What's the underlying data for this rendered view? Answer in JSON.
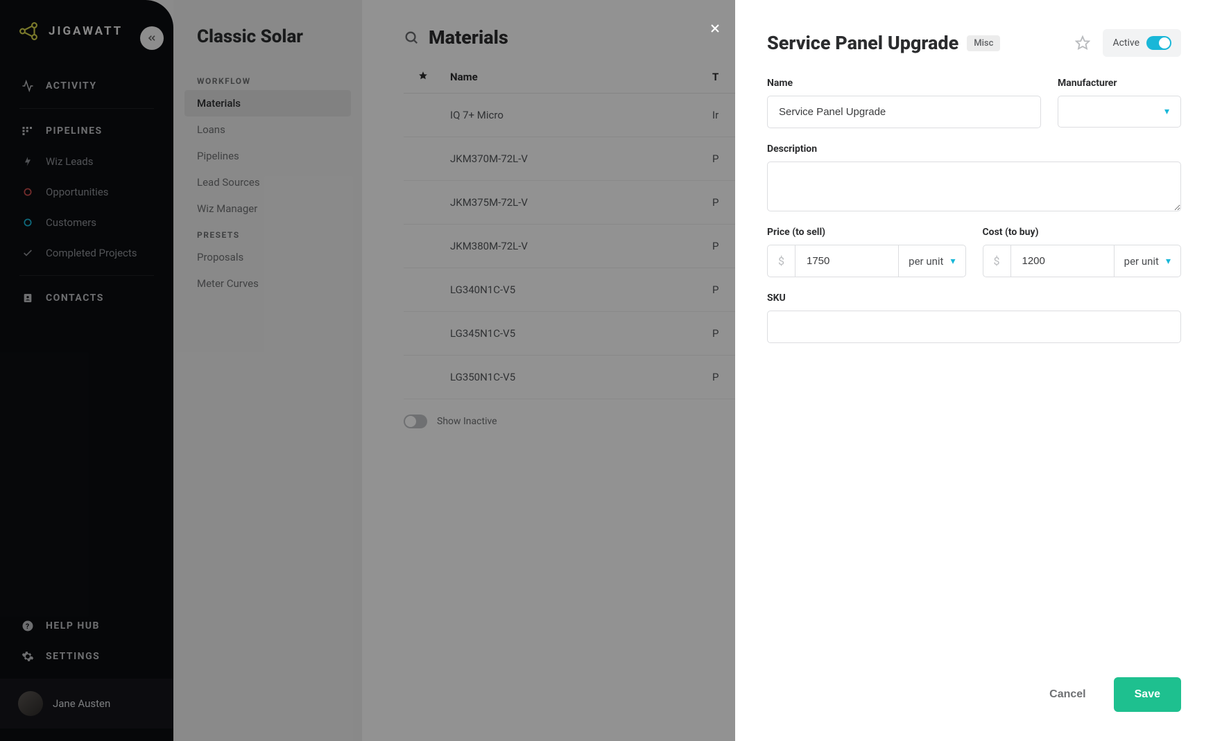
{
  "brand": "JIGAWATT",
  "sidebar": {
    "collapse_tooltip": "Collapse",
    "items": [
      {
        "label": "ACTIVITY",
        "icon": "activity-icon",
        "type": "head"
      },
      {
        "label": "PIPELINES",
        "icon": "pipelines-icon",
        "type": "head"
      },
      {
        "label": "Wiz Leads",
        "icon": "wizard-icon"
      },
      {
        "label": "Opportunities",
        "icon": "circle-red-icon"
      },
      {
        "label": "Customers",
        "icon": "circle-teal-icon"
      },
      {
        "label": "Completed Projects",
        "icon": "check-icon"
      },
      {
        "label": "CONTACTS",
        "icon": "contacts-icon",
        "type": "head"
      }
    ],
    "bottom": [
      {
        "label": "HELP HUB",
        "icon": "help-icon"
      },
      {
        "label": "SETTINGS",
        "icon": "gear-icon"
      }
    ],
    "user": "Jane Austen"
  },
  "subpanel": {
    "title": "Classic Solar",
    "sections": [
      {
        "heading": "WORKFLOW",
        "items": [
          "Materials",
          "Loans",
          "Pipelines",
          "Lead Sources",
          "Wiz Manager"
        ],
        "active": "Materials"
      },
      {
        "heading": "PRESETS",
        "items": [
          "Proposals",
          "Meter Curves"
        ]
      }
    ]
  },
  "main": {
    "title": "Materials",
    "columns": {
      "star": "★",
      "name": "Name",
      "type": "T"
    },
    "rows": [
      {
        "name": "IQ 7+ Micro",
        "type_initial": "Ir"
      },
      {
        "name": "JKM370M-72L-V",
        "type_initial": "P"
      },
      {
        "name": "JKM375M-72L-V",
        "type_initial": "P"
      },
      {
        "name": "JKM380M-72L-V",
        "type_initial": "P"
      },
      {
        "name": "LG340N1C-V5",
        "type_initial": "P"
      },
      {
        "name": "LG345N1C-V5",
        "type_initial": "P"
      },
      {
        "name": "LG350N1C-V5",
        "type_initial": "P"
      }
    ],
    "show_inactive_label": "Show Inactive"
  },
  "panel": {
    "title": "Service Panel Upgrade",
    "tag": "Misc",
    "active_label": "Active",
    "active_state": true,
    "fields": {
      "name_label": "Name",
      "name_value": "Service Panel Upgrade",
      "manufacturer_label": "Manufacturer",
      "manufacturer_value": "",
      "description_label": "Description",
      "description_value": "",
      "price_label": "Price (to sell)",
      "price_value": "1750",
      "price_unit": "per unit",
      "cost_label": "Cost (to buy)",
      "cost_value": "1200",
      "cost_unit": "per unit",
      "sku_label": "SKU",
      "sku_value": ""
    },
    "buttons": {
      "cancel": "Cancel",
      "save": "Save"
    }
  }
}
